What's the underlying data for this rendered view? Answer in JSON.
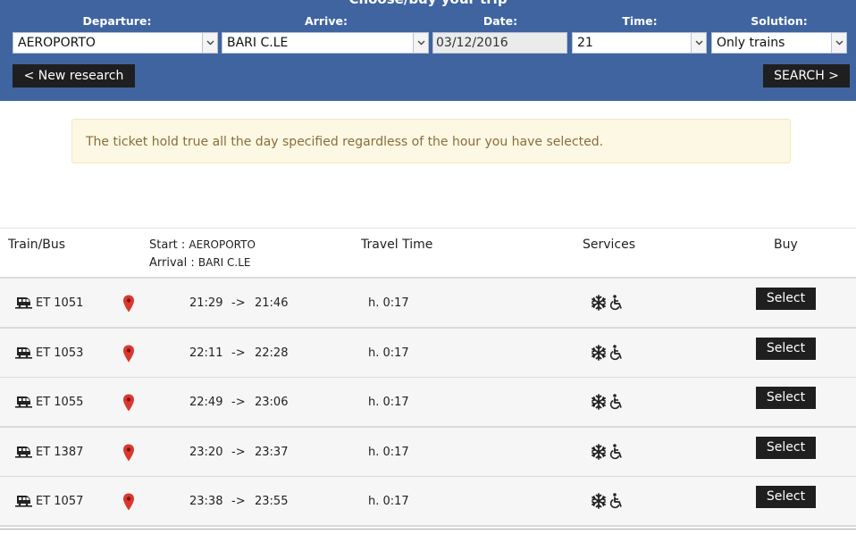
{
  "header": {
    "title": "Choose/buy your trip",
    "labels": {
      "departure": "Departure:",
      "arrive": "Arrive:",
      "date": "Date:",
      "time": "Time:",
      "solution": "Solution:"
    },
    "fields": {
      "departure": "AEROPORTO",
      "arrive": "BARI C.LE",
      "date": "03/12/2016",
      "time": "21",
      "solution": "Only trains"
    },
    "new_research_label": "< New research",
    "search_label": "SEARCH >"
  },
  "notice": "The ticket hold true all the day specified regardless of the hour you have selected.",
  "table": {
    "headers": {
      "train": "Train/Bus",
      "start_label": "Start :",
      "start_value": "AEROPORTO",
      "arrival_label": "Arrival :",
      "arrival_value": "BARI C.LE",
      "travel_time": "Travel Time",
      "services": "Services",
      "buy": "Buy"
    },
    "rows": [
      {
        "train": "ET 1051",
        "depart": "21:29",
        "arrow": "->",
        "arrive": "21:46",
        "duration": "h. 0:17",
        "button": "Select"
      },
      {
        "train": "ET 1053",
        "depart": "22:11",
        "arrow": "->",
        "arrive": "22:28",
        "duration": "h. 0:17",
        "button": "Select"
      },
      {
        "train": "ET 1055",
        "depart": "22:49",
        "arrow": "->",
        "arrive": "23:06",
        "duration": "h. 0:17",
        "button": "Select"
      },
      {
        "train": "ET 1387",
        "depart": "23:20",
        "arrow": "->",
        "arrive": "23:37",
        "duration": "h. 0:17",
        "button": "Select"
      },
      {
        "train": "ET 1057",
        "depart": "23:38",
        "arrow": "->",
        "arrive": "23:55",
        "duration": "h. 0:17",
        "button": "Select"
      }
    ]
  },
  "icons": {
    "train": "train-icon",
    "pin": "map-pin-icon",
    "air_conditioning": "snowflake-icon",
    "accessibility": "wheelchair-icon"
  },
  "colors": {
    "header_bg": "#3f64a0",
    "button_bg": "#1f1f1f",
    "notice_bg": "#fcf8e3",
    "notice_text": "#8a6d3b",
    "pin": "#d9382e",
    "row_bg": "#f6f6f6"
  }
}
